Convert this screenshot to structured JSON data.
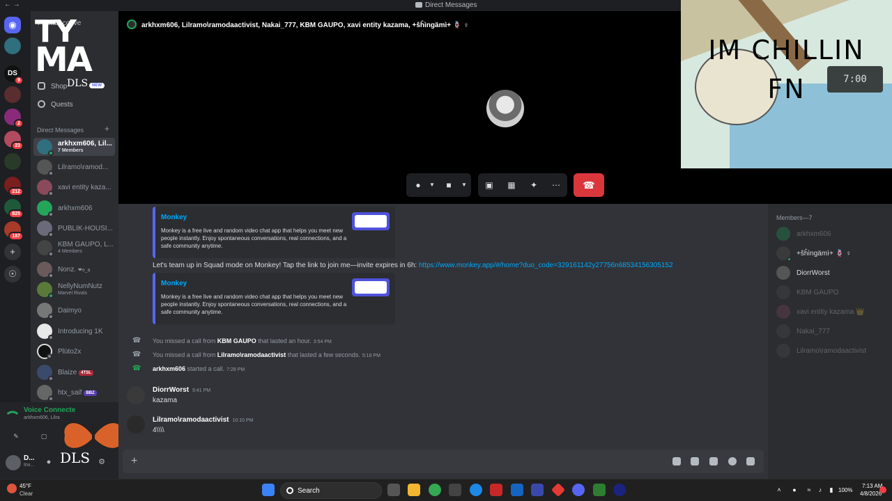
{
  "window": {
    "title": "Direct Messages",
    "nav": "← →"
  },
  "servers": [
    {
      "name": "discord-home",
      "badge": ""
    },
    {
      "name": "server-2",
      "badge": ""
    },
    {
      "name": "server-ds",
      "badge": "9"
    },
    {
      "name": "server-4",
      "badge": ""
    },
    {
      "name": "server-5",
      "badge": "2"
    },
    {
      "name": "server-6",
      "badge": "23"
    },
    {
      "name": "server-7",
      "badge": ""
    },
    {
      "name": "server-8",
      "badge": "212"
    },
    {
      "name": "server-9",
      "badge": "825"
    },
    {
      "name": "server-10",
      "badge": "187"
    }
  ],
  "sidebar": {
    "logo_line1": "TY",
    "logo_line2": "MA",
    "logo_small": "DLS",
    "hidden_label": "Fil",
    "start_conv": "start conve",
    "shop": "Shop",
    "shop_badge": "NEW",
    "quests": "Quests",
    "dm_header": "Direct Messages",
    "dm_add": "+",
    "dms": [
      {
        "name": "arkhxm606, Lil...",
        "sub": "7 Members"
      },
      {
        "name": "Lilramo\\ramod...",
        "sub": ""
      },
      {
        "name": "xavi entity kaza...",
        "sub": ""
      },
      {
        "name": "arkhxm606",
        "sub": ""
      },
      {
        "name": "PUBLIK-HOUSI...",
        "sub": ""
      },
      {
        "name": "KBM GAUPO, L...",
        "sub": "4 Members"
      },
      {
        "name": "Nonz.",
        "sub": ""
      },
      {
        "name": "NellyNumNutz",
        "sub": "Marvel Rivals"
      },
      {
        "name": "Daimyo",
        "sub": ""
      },
      {
        "name": "Introducing 1K",
        "sub": ""
      },
      {
        "name": "Plüto2x",
        "sub": ""
      },
      {
        "name": "Blaize",
        "sub": ""
      },
      {
        "name": "htx_saif",
        "sub": ""
      }
    ],
    "nonz_tag": "❤o_a",
    "blaize_tag": "4TSL",
    "htx_tag": "BBZ"
  },
  "voice": {
    "status": "Voice Connecte",
    "sub": "arkhxm606, Lilra"
  },
  "user": {
    "name": "D...",
    "status": "Inv...",
    "overlay": "DLS"
  },
  "call": {
    "participants": "arkhxm606, Lilramo\\ramodaactivist, Nakai_777, KBM GAUPO, xavi entity kazama, +šĥìngämì+ 🪢 ♀"
  },
  "meme": {
    "line1": "IM CHILLIN",
    "line2": "FN",
    "clock": "7:00"
  },
  "chat": {
    "embed_title": "Monkey",
    "embed_desc": "Monkey is a free live and random video chat app that helps you meet new people instantly. Enjoy spontaneous conversations, real connections, and a safe community anytime.",
    "invite_text": "Let's team up in Squad mode on Monkey! Tap the link to join me—invite expires in 6h: ",
    "invite_link": "https://www.monkey.app/#/home?duo_code=329161142y27756n68534156305152",
    "sys1_pre": "You missed a call from ",
    "sys1_name": "KBM GAUPO",
    "sys1_post": " that lasted an hour.",
    "sys1_time": "3:54 PM",
    "sys2_pre": "You missed a call from ",
    "sys2_name": "Lilramo\\ramodaactivist",
    "sys2_post": " that lasted a few seconds.",
    "sys2_time": "5:18 PM",
    "sys3_name": "arkhxm606",
    "sys3_post": " started a call.",
    "sys3_time": "7:28 PM",
    "msg1_author": "DiorrWorst",
    "msg1_time": "9:41 PM",
    "msg1_body": "kazama",
    "msg2_author": "Lilramo\\ramodaactivist",
    "msg2_time": "10:10 PM",
    "msg2_body": "4\\\\\\\\"
  },
  "members": {
    "header": "Members—7",
    "list": [
      {
        "name": "arkhxm606",
        "online": false
      },
      {
        "name": "+šĥìngämì+ 🪢 ♀",
        "online": true
      },
      {
        "name": "DiorrWorst",
        "online": true
      },
      {
        "name": "KBM GAUPO",
        "online": false
      },
      {
        "name": "xavi entity kazama 👑",
        "online": false
      },
      {
        "name": "Nakai_777",
        "online": false
      },
      {
        "name": "Lilramo\\ramodaactivist",
        "online": false
      }
    ]
  },
  "taskbar": {
    "temp": "45°F",
    "weather": "Clear",
    "search": "Search",
    "battery": "100%",
    "time": "7:13 AM",
    "date": "4/8/2026"
  }
}
